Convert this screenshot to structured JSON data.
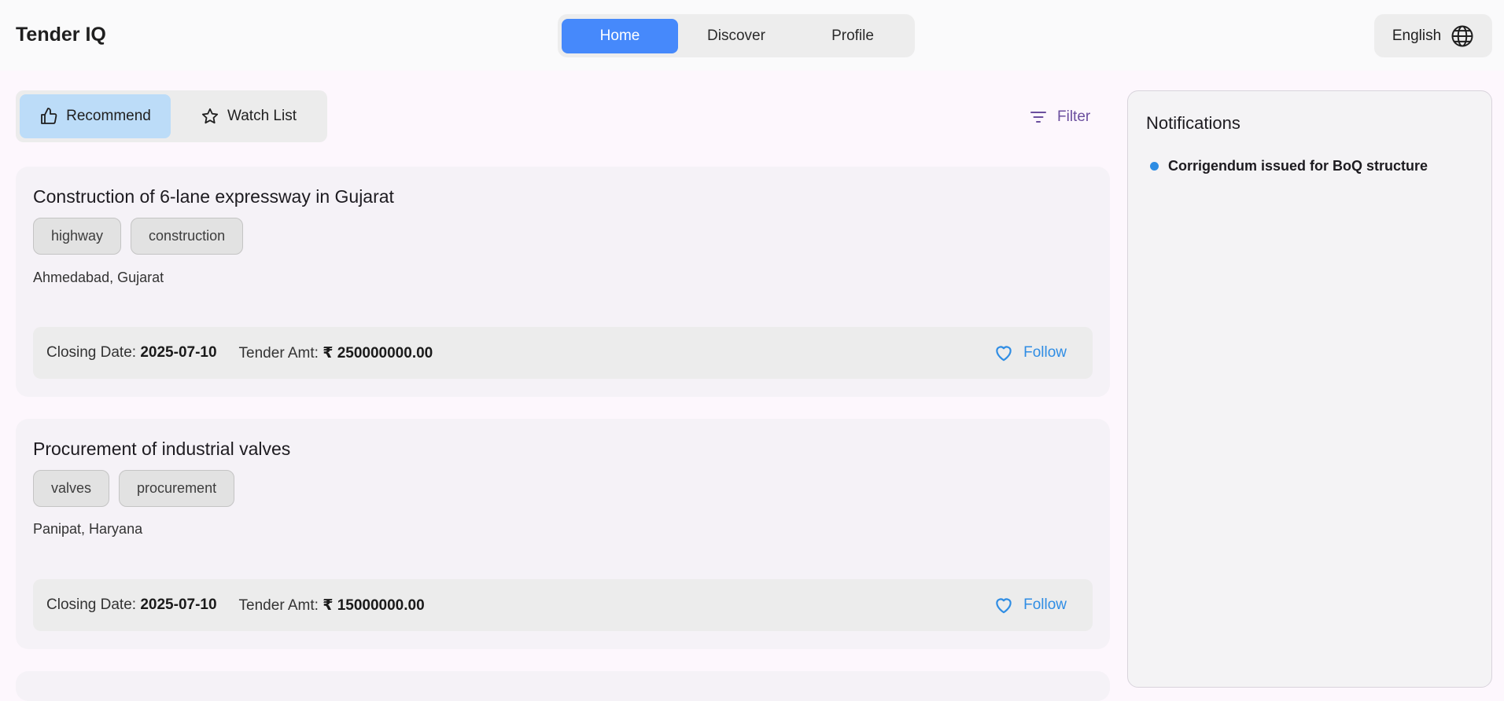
{
  "app": {
    "title": "Tender IQ"
  },
  "nav": {
    "items": [
      "Home",
      "Discover",
      "Profile"
    ],
    "active": "Home"
  },
  "language": {
    "label": "English",
    "icon": "globe-icon"
  },
  "toolbar": {
    "recommend_label": "Recommend",
    "watchlist_label": "Watch List",
    "filter_label": "Filter"
  },
  "tenders": [
    {
      "title": "Construction of 6-lane expressway in Gujarat",
      "tags": [
        "highway",
        "construction"
      ],
      "location": "Ahmedabad, Gujarat",
      "closing_label": "Closing Date:",
      "closing_date": "2025-07-10",
      "amount_label": "Tender Amt:",
      "amount": "₹ 250000000.00",
      "follow_label": "Follow"
    },
    {
      "title": "Procurement of industrial valves",
      "tags": [
        "valves",
        "procurement"
      ],
      "location": "Panipat, Haryana",
      "closing_label": "Closing Date:",
      "closing_date": "2025-07-10",
      "amount_label": "Tender Amt:",
      "amount": "₹ 15000000.00",
      "follow_label": "Follow"
    }
  ],
  "notifications": {
    "title": "Notifications",
    "items": [
      "Corrigendum issued for BoQ structure"
    ]
  },
  "colors": {
    "accent": "#4689fb",
    "recommend_bg": "#bcdcf8",
    "follow": "#2f8de4",
    "filter": "#6b4f9e"
  }
}
